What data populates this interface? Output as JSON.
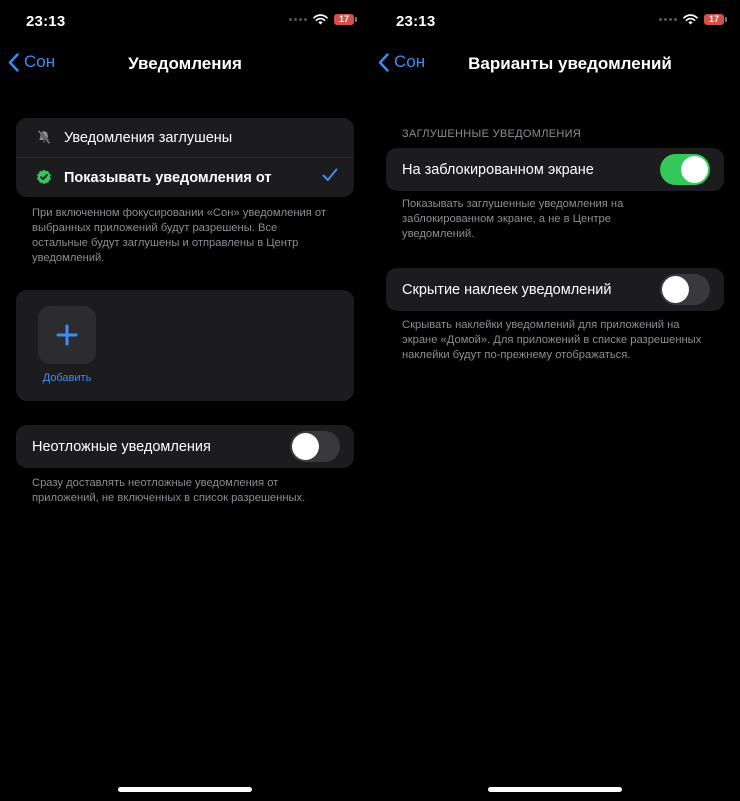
{
  "status_bar": {
    "time": "23:13",
    "battery": "17"
  },
  "colors": {
    "accent": "#3a8ef6",
    "toggle_on": "#34c759",
    "background": "#000000",
    "card": "#1c1c1e"
  },
  "left": {
    "back_label": "Сон",
    "title": "Уведомления",
    "options": [
      {
        "label": "Уведомления заглушены",
        "icon": "bell-slash-icon",
        "selected": false
      },
      {
        "label": "Показывать уведомления от",
        "icon": "green-badge-check-icon",
        "selected": true
      }
    ],
    "options_footnote": "При включенном фокусировании «Сон» уведомления от выбранных приложений будут разрешены. Все остальные будут заглушены и отправлены в Центр уведомлений.",
    "add_label": "Добавить",
    "urgent": {
      "label": "Неотложные уведомления",
      "enabled": false
    },
    "urgent_footnote": "Сразу доставлять неотложные уведомления от приложений, не включенных в список разрешенных."
  },
  "right": {
    "back_label": "Сон",
    "title": "Варианты уведомлений",
    "section_header": "ЗАГЛУШЕННЫЕ УВЕДОМЛЕНИЯ",
    "lock_screen": {
      "label": "На заблокированном экране",
      "enabled": true
    },
    "lock_screen_footnote": "Показывать заглушенные уведомления на заблокированном экране, а не в Центре уведомлений.",
    "badges": {
      "label": "Скрытие наклеек уведомлений",
      "enabled": false
    },
    "badges_footnote": "Скрывать наклейки уведомлений для приложений на экране «Домой». Для приложений в списке разрешенных наклейки будут по-прежнему отображаться."
  }
}
